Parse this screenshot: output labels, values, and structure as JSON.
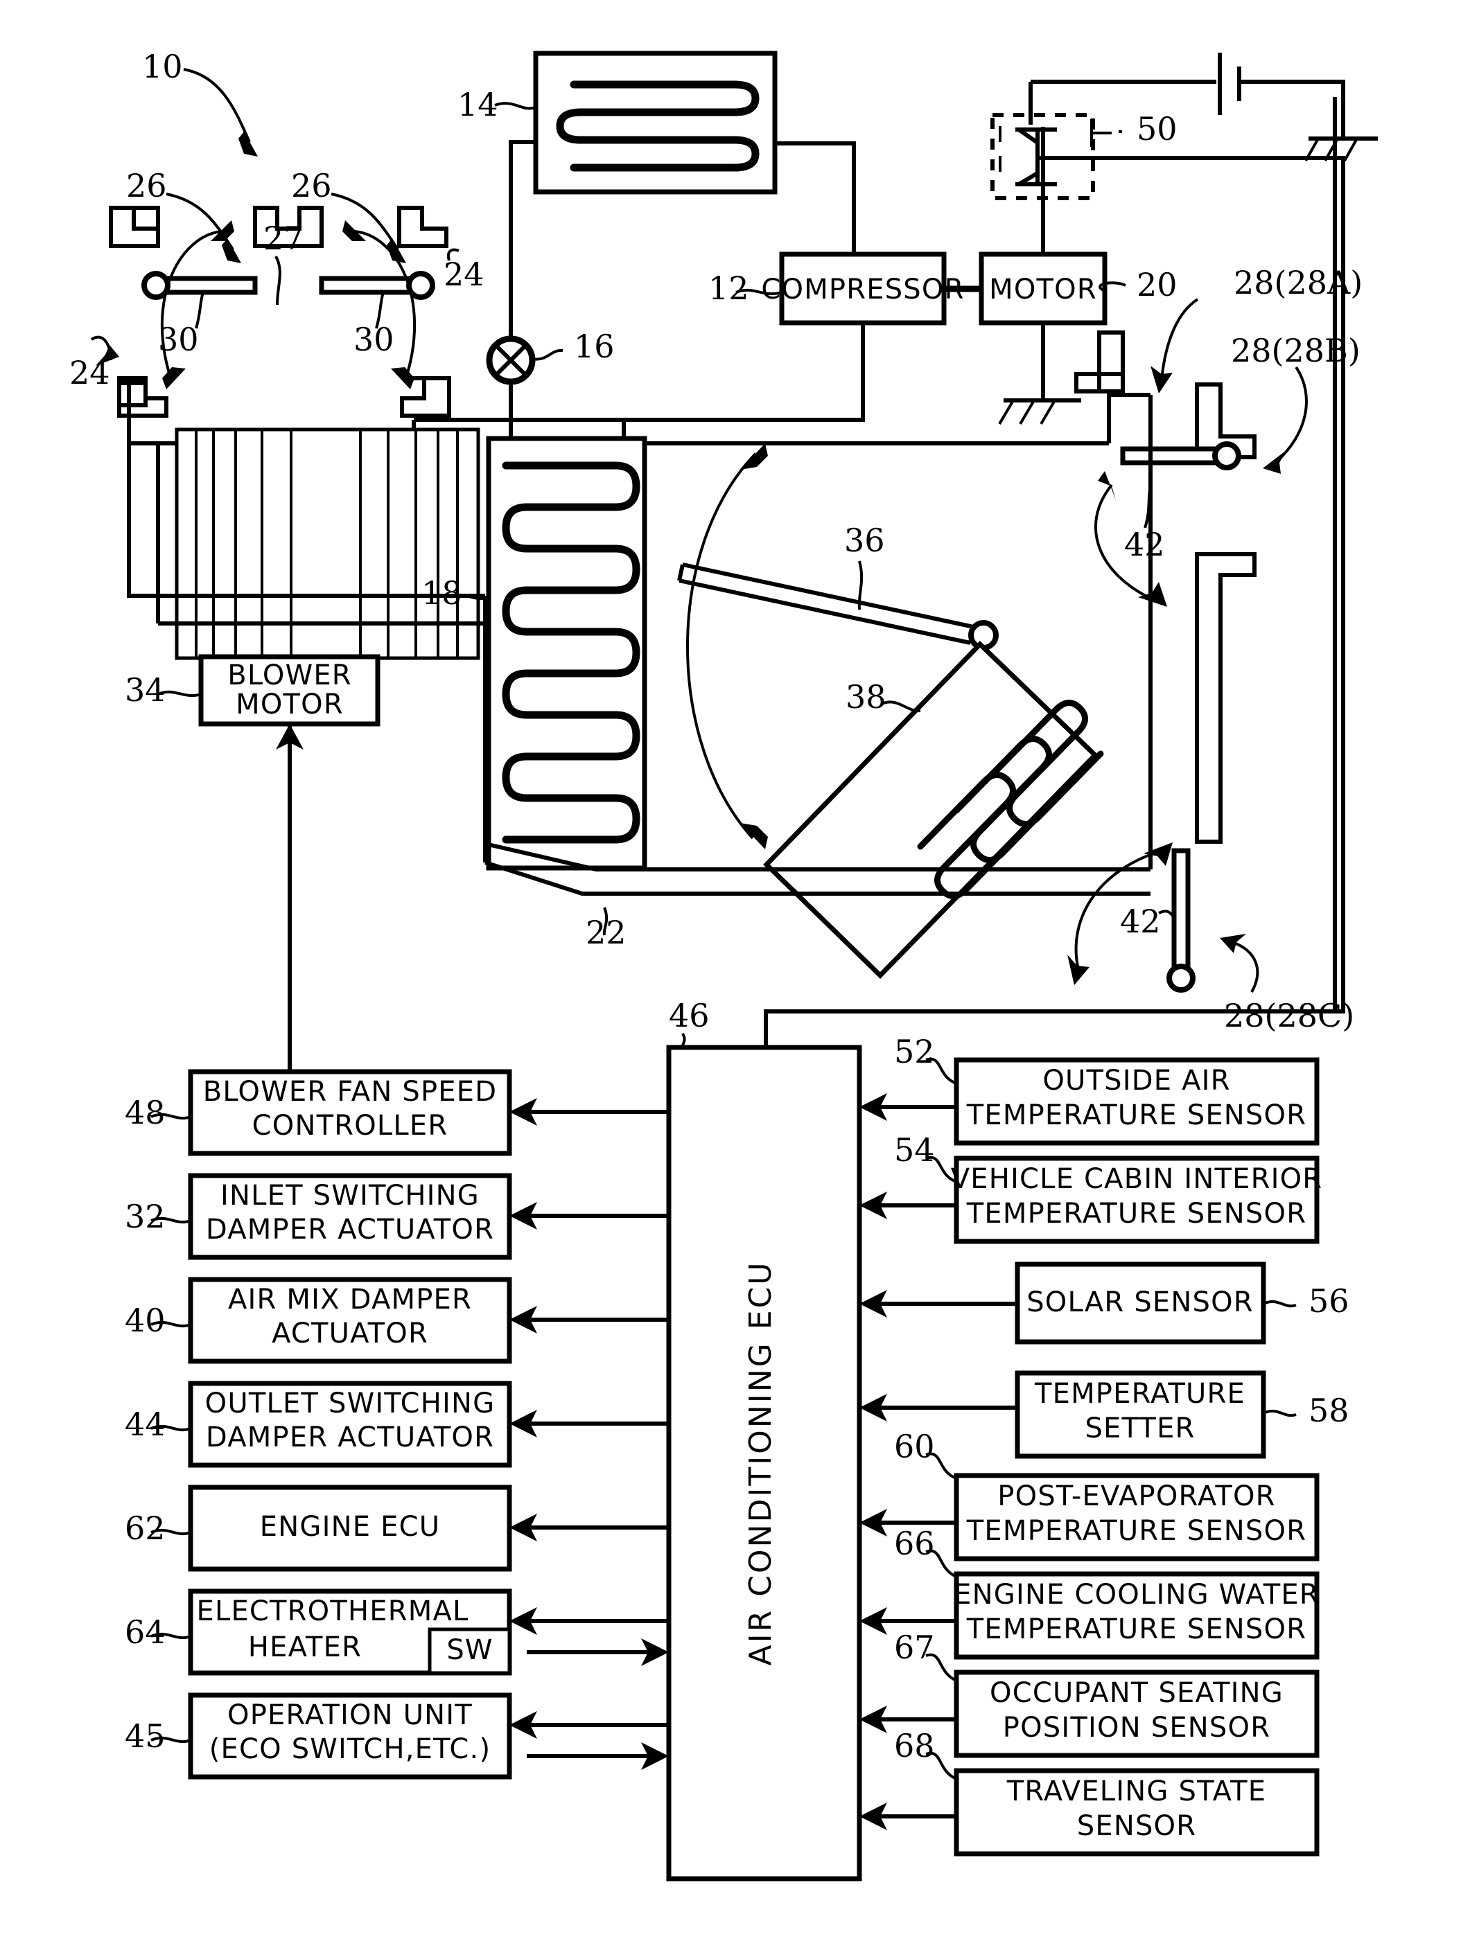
{
  "figure": {
    "domain": "patent-diagram",
    "title_number": "10",
    "description": "Vehicle air conditioning system schematic with refrigeration cycle and air conditioning ECU block diagram"
  },
  "reference_numerals": {
    "system": "10",
    "compressor": "12",
    "condenser": "14",
    "expansion_valve": "16",
    "evaporator": "18",
    "motor": "20",
    "duct": "22",
    "inlet_ports": "24",
    "inlet_switching_dampers": "26",
    "blower_fan": "27",
    "outlet_ports": "28",
    "outlet_a": "28(28A)",
    "outlet_b": "28(28B)",
    "outlet_c": "28(28C)",
    "damper_rotation_inlet": "30",
    "inlet_damper_actuator": "32",
    "blower_motor": "34",
    "air_mix_damper": "36",
    "heater_core": "38",
    "air_mix_damper_actuator": "40",
    "damper_rotation_outlet": "42",
    "outlet_damper_actuator": "44",
    "operation_unit": "45",
    "air_conditioning_ecu": "46",
    "blower_fan_speed_controller": "48",
    "inverter_switch": "50",
    "outside_air_temperature_sensor": "52",
    "vehicle_cabin_interior_temperature_sensor": "54",
    "solar_sensor": "56",
    "temperature_setter": "58",
    "post_evaporator_temperature_sensor": "60",
    "engine_ecu": "62",
    "electrothermal_heater": "64",
    "engine_cooling_water_temperature_sensor": "66",
    "occupant_seating_position_sensor": "67",
    "traveling_state_sensor": "68"
  },
  "refrigeration_cycle": {
    "compressor": {
      "label": "COMPRESSOR",
      "ref": "12"
    },
    "motor": {
      "label": "MOTOR",
      "ref": "20"
    },
    "condenser": {
      "ref": "14"
    },
    "expansion_valve": {
      "ref": "16"
    },
    "evaporator": {
      "ref": "18"
    },
    "inverter_switch": {
      "ref": "50"
    }
  },
  "hvac_unit": {
    "blower_motor": {
      "label_line1": "BLOWER",
      "label_line2": "MOTOR",
      "ref": "34"
    },
    "blower_fan": {
      "ref": "27"
    },
    "heater_core": {
      "ref": "38"
    },
    "air_mix_damper": {
      "ref": "36"
    },
    "duct": {
      "ref": "22"
    },
    "inlet_ports": {
      "ref": "24"
    },
    "inlet_dampers": {
      "ref": "26",
      "rotation_ref": "30"
    },
    "outlets": [
      {
        "ref": "28(28A)"
      },
      {
        "ref": "28(28B)"
      },
      {
        "ref": "28(28C)"
      }
    ],
    "outlet_rotation_ref": "42"
  },
  "ecu": {
    "label": "AIR CONDITIONING ECU",
    "ref": "46"
  },
  "left_blocks": [
    {
      "ref": "48",
      "lines": [
        "BLOWER FAN SPEED",
        "CONTROLLER"
      ],
      "arrow": "in"
    },
    {
      "ref": "32",
      "lines": [
        "INLET SWITCHING",
        "DAMPER ACTUATOR"
      ],
      "arrow": "in"
    },
    {
      "ref": "40",
      "lines": [
        "AIR MIX DAMPER",
        "ACTUATOR"
      ],
      "arrow": "in"
    },
    {
      "ref": "44",
      "lines": [
        "OUTLET SWITCHING",
        "DAMPER ACTUATOR"
      ],
      "arrow": "in"
    },
    {
      "ref": "62",
      "lines": [
        "ENGINE ECU"
      ],
      "arrow": "in"
    },
    {
      "ref": "64",
      "lines": [
        "ELECTROTHERMAL",
        "HEATER"
      ],
      "sub_label": "SW",
      "arrow": "both"
    },
    {
      "ref": "45",
      "lines": [
        "OPERATION UNIT",
        "(ECO SWITCH,ETC.)"
      ],
      "arrow": "both"
    }
  ],
  "right_blocks": [
    {
      "ref": "52",
      "lines": [
        "OUTSIDE AIR",
        "TEMPERATURE SENSOR"
      ],
      "wide": true
    },
    {
      "ref": "54",
      "lines": [
        "VEHICLE CABIN INTERIOR",
        "TEMPERATURE SENSOR"
      ],
      "wide": true
    },
    {
      "ref": "56",
      "lines": [
        "SOLAR SENSOR"
      ],
      "wide": false
    },
    {
      "ref": "58",
      "lines": [
        "TEMPERATURE",
        "SETTER"
      ],
      "wide": false
    },
    {
      "ref": "60",
      "lines": [
        "POST-EVAPORATOR",
        "TEMPERATURE SENSOR"
      ],
      "wide": true
    },
    {
      "ref": "66",
      "lines": [
        "ENGINE COOLING WATER",
        "TEMPERATURE SENSOR"
      ],
      "wide": true
    },
    {
      "ref": "67",
      "lines": [
        "OCCUPANT SEATING",
        "POSITION SENSOR"
      ],
      "wide": true
    },
    {
      "ref": "68",
      "lines": [
        "TRAVELING STATE",
        "SENSOR"
      ],
      "wide": true
    }
  ]
}
